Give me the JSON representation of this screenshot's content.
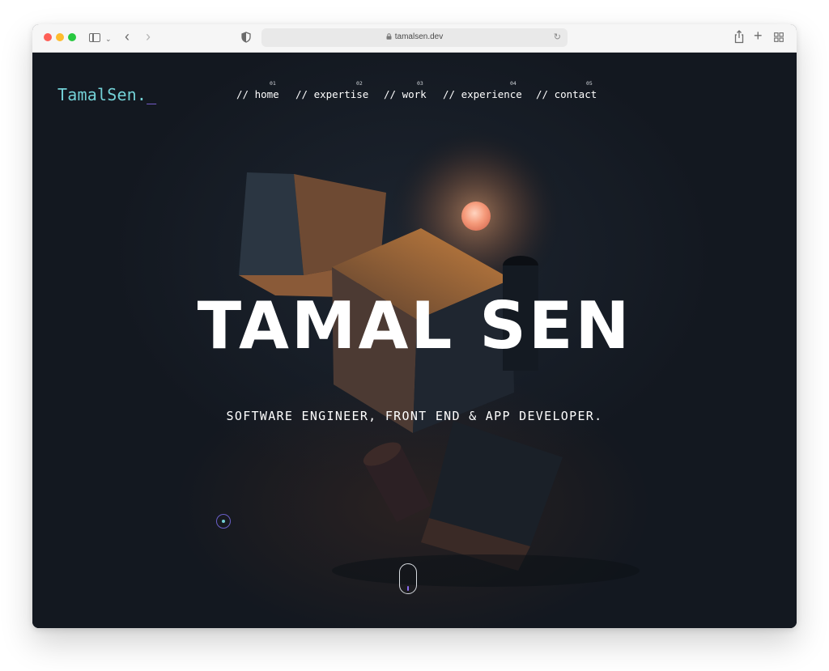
{
  "browser": {
    "url": "tamalsen.dev",
    "traffic_lights": {
      "close": "#fe5f57",
      "minimize": "#febc2e",
      "zoom": "#28c840"
    }
  },
  "site": {
    "logo_text": "TamalSen.",
    "logo_cursor": "_",
    "nav": [
      {
        "num": "01",
        "label": "// home"
      },
      {
        "num": "02",
        "label": "// expertise"
      },
      {
        "num": "03",
        "label": "// work"
      },
      {
        "num": "04",
        "label": "// experience"
      },
      {
        "num": "05",
        "label": "// contact"
      }
    ],
    "hero_title": "TAMAL SEN",
    "hero_subtitle": "SOFTWARE ENGINEER, FRONT END & APP DEVELOPER."
  },
  "colors": {
    "background": "#151b23",
    "logo": "#73d1d6",
    "accent": "#8a6cf0",
    "text": "#ffffff"
  },
  "icons": [
    "sidebar-icon",
    "chevron-down-icon",
    "back-icon",
    "forward-icon",
    "shield-icon",
    "lock-icon",
    "reload-icon",
    "share-icon",
    "plus-icon",
    "tabs-overview-icon",
    "cursor-dot-icon",
    "scroll-mouse-icon"
  ]
}
